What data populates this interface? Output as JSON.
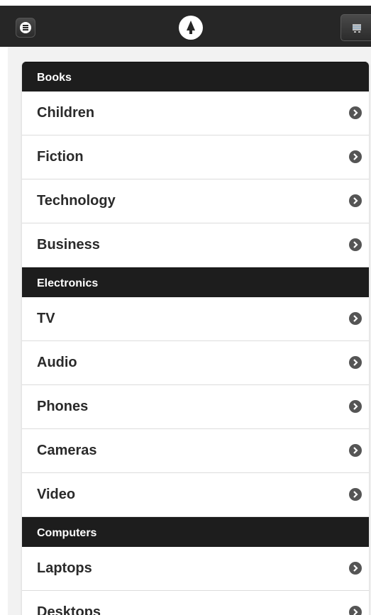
{
  "header": {
    "menu_icon": "menu-icon",
    "logo_icon": "tree-logo-icon",
    "cart_icon": "cart-icon"
  },
  "colors": {
    "header_bg": "#262626",
    "divider_bg": "#1d1d1d",
    "page_bg": "#f2f2f2",
    "item_text": "#2a2a2a",
    "arrow_bg": "#555555"
  },
  "groups": [
    {
      "title": "Books",
      "items": [
        {
          "label": "Children"
        },
        {
          "label": "Fiction"
        },
        {
          "label": "Technology"
        },
        {
          "label": "Business"
        }
      ]
    },
    {
      "title": "Electronics",
      "items": [
        {
          "label": "TV"
        },
        {
          "label": "Audio"
        },
        {
          "label": "Phones"
        },
        {
          "label": "Cameras"
        },
        {
          "label": "Video"
        }
      ]
    },
    {
      "title": "Computers",
      "items": [
        {
          "label": "Laptops"
        },
        {
          "label": "Desktops"
        }
      ]
    }
  ]
}
